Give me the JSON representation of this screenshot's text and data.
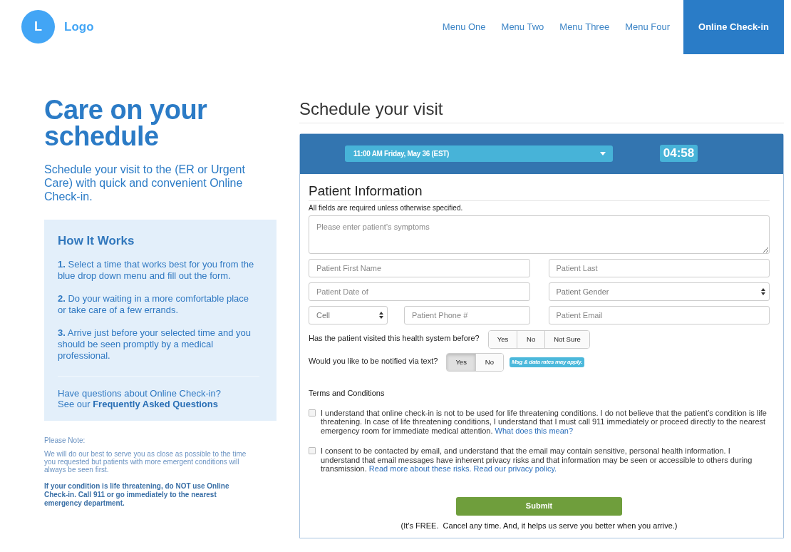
{
  "header": {
    "logo": {
      "letter": "L",
      "text": "Logo"
    },
    "nav": [
      {
        "label": "Menu One",
        "selected": false
      },
      {
        "label": "Menu Two",
        "selected": false
      },
      {
        "label": "Menu Three",
        "selected": false
      },
      {
        "label": "Menu Four",
        "selected": false
      },
      {
        "label": "Online Check-in",
        "selected": true
      }
    ]
  },
  "intro": {
    "title": "Care on your schedule",
    "subtitle": "Schedule your visit to the (ER or Urgent Care) with quick and convenient Online Check-in."
  },
  "how_it_works": {
    "title": "How It Works",
    "steps": [
      "**1.** Select a time that works best for you from the blue drop down menu and fill out the form.",
      "**2.** Do your waiting in a more comfortable place or take care of a few errands.",
      "**3.** Arrive just before your selected time and you should be seen promptly by a medical professional."
    ],
    "faq": {
      "question": "Have questions about Online Check-in?",
      "prefix": "See our",
      "link": "Frequently Asked Questions"
    }
  },
  "notes": {
    "label": "Please Note:",
    "text": "We will do our best to serve you as close as possible to the time you requested but patients with more emergent conditions will always be seen first.",
    "warning": "If your condition is life threatening, do NOT use Online Check-in. Call 911 or go immediately to the nearest emergency department."
  },
  "form": {
    "title": "Schedule your visit",
    "time_select": {
      "value": "11:00 AM Friday, May 36 (EST)"
    },
    "timer": "04:58",
    "section_title": "Patient Information",
    "required_note": "All fields are required unless otherwise specified.",
    "symptoms": {
      "placeholder": "Please enter patient’s symptoms"
    },
    "rows": [
      [
        {
          "kind": "input",
          "placeholder": "Patient First Name"
        },
        {
          "kind": "input",
          "placeholder": "Patient Last"
        }
      ],
      [
        {
          "kind": "input",
          "placeholder": "Patient Date of"
        },
        {
          "kind": "select",
          "value": "Patient Gender"
        }
      ],
      [
        {
          "kind": "select",
          "value": "Cell"
        },
        {
          "kind": "input",
          "placeholder": "Patient Phone #"
        },
        {
          "kind": "input",
          "placeholder": "Patient Email"
        }
      ]
    ],
    "questions": [
      {
        "label": "Has the patient visited this health system before?",
        "options": [
          {
            "label": "Yes",
            "selected": false
          },
          {
            "label": "No",
            "selected": false
          },
          {
            "label": "Not Sure",
            "selected": false
          }
        ]
      },
      {
        "label": "Would you like to be notified via text?",
        "options": [
          {
            "label": "Yes",
            "selected": true
          },
          {
            "label": "No",
            "selected": false
          }
        ],
        "note": "Msg & data rates may apply."
      }
    ],
    "terms": {
      "title": "Terms and Conditions",
      "items": [
        {
          "checked": false,
          "text": "I understand that online check-in is not to be used for life threatening conditions. I do not believe that the patient’s condition is life threatening. In case of life threatening conditions, I understand that I must call 911 immediately or proceed directly to the nearest emergency room for immediate medical attention.",
          "links": [
            "What does this mean?"
          ]
        },
        {
          "checked": false,
          "text": "I consent to be contacted by email, and understand that the email may contain sensitive, personal health information. I understand that email messages have inherent privacy risks and that information may be seen or accessible to others during transmission.",
          "links": [
            "Read more about these risks.",
            "Read our privacy policy."
          ]
        }
      ]
    },
    "submit": "Submit",
    "footnote": "(It’s FREE.  Cancel any time. And, it helps us serve you better when you arrive.)"
  }
}
